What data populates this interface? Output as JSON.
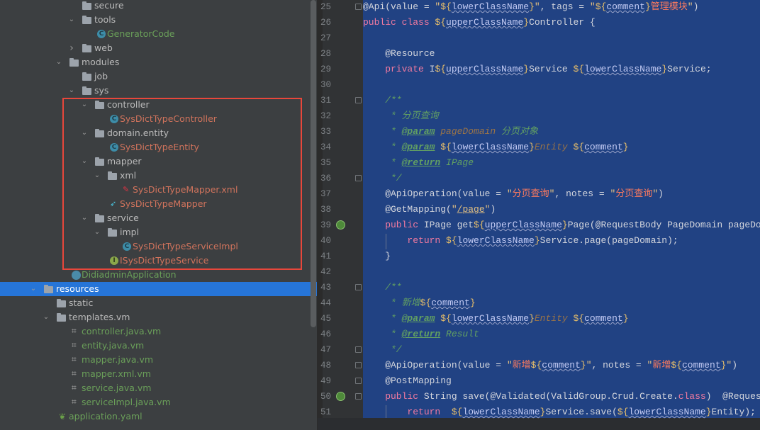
{
  "tree": [
    {
      "label": "secure",
      "depth": 6,
      "kind": "folder",
      "chev": false
    },
    {
      "label": "tools",
      "depth": 6,
      "kind": "folder",
      "chev": true
    },
    {
      "label": "GeneratorCode",
      "depth": 7,
      "kind": "cls",
      "color": "green"
    },
    {
      "label": "web",
      "depth": 6,
      "kind": "folder",
      "chev": "closed"
    },
    {
      "label": "modules",
      "depth": 5,
      "kind": "folder",
      "chev": true
    },
    {
      "label": "job",
      "depth": 6,
      "kind": "folder"
    },
    {
      "label": "sys",
      "depth": 6,
      "kind": "folder",
      "chev": true
    },
    {
      "label": "controller",
      "depth": 7,
      "kind": "folder",
      "chev": true
    },
    {
      "label": "SysDictTypeController",
      "depth": 8,
      "kind": "cls",
      "color": "red"
    },
    {
      "label": "domain.entity",
      "depth": 7,
      "kind": "folder",
      "chev": true
    },
    {
      "label": "SysDictTypeEntity",
      "depth": 8,
      "kind": "cls",
      "color": "red"
    },
    {
      "label": "mapper",
      "depth": 7,
      "kind": "folder",
      "chev": true
    },
    {
      "label": "xml",
      "depth": 8,
      "kind": "folder",
      "chev": true
    },
    {
      "label": "SysDictTypeMapper.xml",
      "depth": 9,
      "kind": "xml",
      "color": "red"
    },
    {
      "label": "SysDictTypeMapper",
      "depth": 8,
      "kind": "mapper",
      "color": "red"
    },
    {
      "label": "service",
      "depth": 7,
      "kind": "folder",
      "chev": true
    },
    {
      "label": "impl",
      "depth": 8,
      "kind": "folder",
      "chev": true
    },
    {
      "label": "SysDictTypeServiceImpl",
      "depth": 9,
      "kind": "cls",
      "color": "red"
    },
    {
      "label": "ISysDictTypeService",
      "depth": 8,
      "kind": "intf",
      "color": "red"
    },
    {
      "label": "DidiadminApplication",
      "depth": 5,
      "kind": "app",
      "color": "green"
    },
    {
      "label": "resources",
      "depth": 3,
      "kind": "folder",
      "chev": true,
      "selected": true
    },
    {
      "label": "static",
      "depth": 4,
      "kind": "folder"
    },
    {
      "label": "templates.vm",
      "depth": 4,
      "kind": "folder",
      "chev": true
    },
    {
      "label": "controller.java.vm",
      "depth": 5,
      "kind": "vm",
      "color": "green"
    },
    {
      "label": "entity.java.vm",
      "depth": 5,
      "kind": "vm",
      "color": "green"
    },
    {
      "label": "mapper.java.vm",
      "depth": 5,
      "kind": "vm",
      "color": "green"
    },
    {
      "label": "mapper.xml.vm",
      "depth": 5,
      "kind": "vm",
      "color": "green"
    },
    {
      "label": "service.java.vm",
      "depth": 5,
      "kind": "vm",
      "color": "green"
    },
    {
      "label": "serviceImpl.java.vm",
      "depth": 5,
      "kind": "vm",
      "color": "green"
    },
    {
      "label": "application.yaml",
      "depth": 4,
      "kind": "yaml",
      "color": "green"
    }
  ],
  "editor": {
    "first_line": 25,
    "fold_lines": [
      25,
      31,
      36,
      43,
      47,
      48,
      49,
      50
    ],
    "run_lines": [
      39,
      50
    ],
    "lines": [
      [
        [
          "a",
          "@Api(value = "
        ],
        [
          "s",
          "\""
        ],
        [
          "d",
          "${"
        ],
        [
          "v",
          "lowerClassName"
        ],
        [
          "d",
          "}"
        ],
        [
          "s",
          "\""
        ],
        [
          "pl",
          ", tags = "
        ],
        [
          "s",
          "\""
        ],
        [
          "d",
          "${"
        ],
        [
          "v",
          "comment"
        ],
        [
          "d",
          "}"
        ],
        [
          "cn",
          "管理模块"
        ],
        [
          "s",
          "\""
        ],
        [
          "pl",
          ")"
        ]
      ],
      [
        [
          "k",
          "public class "
        ],
        [
          "d",
          "${"
        ],
        [
          "v",
          "upperClassName"
        ],
        [
          "d",
          "}"
        ],
        [
          "pl",
          "Controller {"
        ]
      ],
      [],
      [
        [
          "pl",
          "    @Resource"
        ]
      ],
      [
        [
          "k",
          "    private "
        ],
        [
          "pl",
          "I"
        ],
        [
          "d",
          "${"
        ],
        [
          "v",
          "upperClassName"
        ],
        [
          "d",
          "}"
        ],
        [
          "pl",
          "Service "
        ],
        [
          "d",
          "${"
        ],
        [
          "v",
          "lowerClassName"
        ],
        [
          "d",
          "}"
        ],
        [
          "pl",
          "Service;"
        ]
      ],
      [],
      [
        [
          "c",
          "    /**"
        ]
      ],
      [
        [
          "c",
          "     * 分页查询"
        ]
      ],
      [
        [
          "c",
          "     * "
        ],
        [
          "t",
          "@param"
        ],
        [
          "p",
          " pageDomain"
        ],
        [
          "c",
          " 分页对象"
        ]
      ],
      [
        [
          "c",
          "     * "
        ],
        [
          "t",
          "@param"
        ],
        [
          "pl",
          " "
        ],
        [
          "d",
          "${"
        ],
        [
          "v",
          "lowerClassName"
        ],
        [
          "d",
          "}"
        ],
        [
          "p",
          "Entity"
        ],
        [
          "pl",
          " "
        ],
        [
          "d",
          "${"
        ],
        [
          "v",
          "comment"
        ],
        [
          "d",
          "}"
        ]
      ],
      [
        [
          "c",
          "     * "
        ],
        [
          "t",
          "@return"
        ],
        [
          "c",
          " IPage"
        ]
      ],
      [
        [
          "c",
          "     */"
        ]
      ],
      [
        [
          "pl",
          "    @ApiOperation(value = "
        ],
        [
          "s",
          "\""
        ],
        [
          "cn",
          "分页查询"
        ],
        [
          "s",
          "\""
        ],
        [
          "pl",
          ", notes = "
        ],
        [
          "s",
          "\""
        ],
        [
          "cn",
          "分页查询"
        ],
        [
          "s",
          "\""
        ],
        [
          "pl",
          ")"
        ]
      ],
      [
        [
          "pl",
          "    @GetMapping("
        ],
        [
          "s",
          "\""
        ],
        [
          "r",
          "/page"
        ],
        [
          "s",
          "\""
        ],
        [
          "pl",
          ")"
        ]
      ],
      [
        [
          "k",
          "    public "
        ],
        [
          "pl",
          "IPage get"
        ],
        [
          "d",
          "${"
        ],
        [
          "v",
          "upperClassName"
        ],
        [
          "d",
          "}"
        ],
        [
          "pl",
          "Page(@RequestBody PageDomain pageDomain"
        ]
      ],
      [
        [
          "k",
          "        return "
        ],
        [
          "d",
          "${"
        ],
        [
          "v",
          "lowerClassName"
        ],
        [
          "d",
          "}"
        ],
        [
          "pl",
          "Service.page(pageDomain);"
        ]
      ],
      [
        [
          "pl",
          "    }"
        ]
      ],
      [],
      [
        [
          "c",
          "    /**"
        ]
      ],
      [
        [
          "c",
          "     * 新增"
        ],
        [
          "d",
          "${"
        ],
        [
          "v",
          "comment"
        ],
        [
          "d",
          "}"
        ]
      ],
      [
        [
          "c",
          "     * "
        ],
        [
          "t",
          "@param"
        ],
        [
          "pl",
          " "
        ],
        [
          "d",
          "${"
        ],
        [
          "v",
          "lowerClassName"
        ],
        [
          "d",
          "}"
        ],
        [
          "p",
          "Entity"
        ],
        [
          "pl",
          " "
        ],
        [
          "d",
          "${"
        ],
        [
          "v",
          "comment"
        ],
        [
          "d",
          "}"
        ]
      ],
      [
        [
          "c",
          "     * "
        ],
        [
          "t",
          "@return"
        ],
        [
          "c",
          " Result"
        ]
      ],
      [
        [
          "c",
          "     */"
        ]
      ],
      [
        [
          "pl",
          "    @ApiOperation(value = "
        ],
        [
          "s",
          "\""
        ],
        [
          "cn",
          "新增"
        ],
        [
          "d",
          "${"
        ],
        [
          "v",
          "comment"
        ],
        [
          "d",
          "}"
        ],
        [
          "s",
          "\""
        ],
        [
          "pl",
          ", notes = "
        ],
        [
          "s",
          "\""
        ],
        [
          "cn",
          "新增"
        ],
        [
          "d",
          "${"
        ],
        [
          "v",
          "comment"
        ],
        [
          "d",
          "}"
        ],
        [
          "s",
          "\""
        ],
        [
          "pl",
          ")"
        ]
      ],
      [
        [
          "pl",
          "    @PostMapping"
        ]
      ],
      [
        [
          "k",
          "    public "
        ],
        [
          "pl",
          "String save(@Validated(ValidGroup.Crud.Create."
        ],
        [
          "k",
          "class"
        ],
        [
          "pl",
          ")  @RequestBody"
        ]
      ],
      [
        [
          "k",
          "        return  "
        ],
        [
          "d",
          "${"
        ],
        [
          "v",
          "lowerClassName"
        ],
        [
          "d",
          "}"
        ],
        [
          "pl",
          "Service.save("
        ],
        [
          "d",
          "${"
        ],
        [
          "v",
          "lowerClassName"
        ],
        [
          "d",
          "}"
        ],
        [
          "pl",
          "Entity);"
        ]
      ]
    ]
  }
}
